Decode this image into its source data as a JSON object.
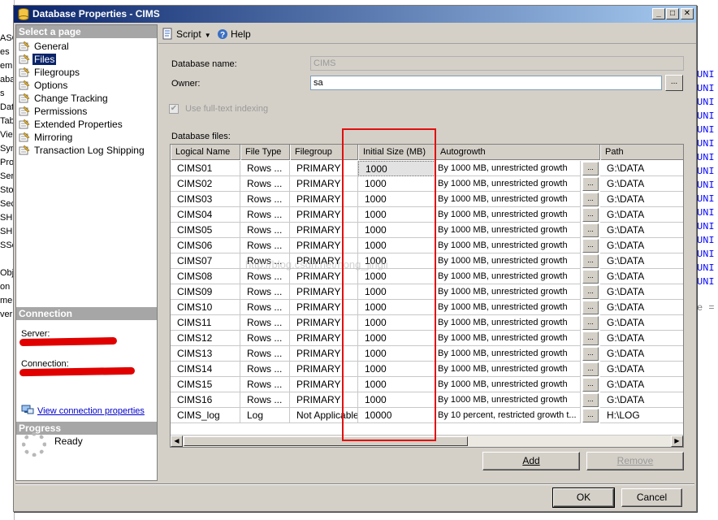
{
  "window": {
    "title": "Database Properties - CIMS",
    "controls": {
      "minimize": "_",
      "maximize": "□",
      "close": "✕"
    }
  },
  "left_pane": {
    "select_page_header": "Select a page",
    "pages": [
      {
        "label": "General",
        "selected": false
      },
      {
        "label": "Files",
        "selected": true
      },
      {
        "label": "Filegroups",
        "selected": false
      },
      {
        "label": "Options",
        "selected": false
      },
      {
        "label": "Change Tracking",
        "selected": false
      },
      {
        "label": "Permissions",
        "selected": false
      },
      {
        "label": "Extended Properties",
        "selected": false
      },
      {
        "label": "Mirroring",
        "selected": false
      },
      {
        "label": "Transaction Log Shipping",
        "selected": false
      }
    ],
    "connection_header": "Connection",
    "server_label": "Server:",
    "connection_label": "Connection:",
    "view_connection_link": "View connection properties",
    "progress_header": "Progress",
    "progress_status": "Ready"
  },
  "toolbar": {
    "script_label": "Script",
    "help_label": "Help"
  },
  "form": {
    "database_name_label": "Database name:",
    "database_name_value": "CIMS",
    "owner_label": "Owner:",
    "owner_value": "sa",
    "owner_browse": "...",
    "fulltext_label": "Use full-text indexing",
    "fulltext_checked": true,
    "database_files_label": "Database files:"
  },
  "grid": {
    "columns": [
      "Logical Name",
      "File Type",
      "Filegroup",
      "Initial Size (MB)",
      "Autogrowth",
      "Path"
    ],
    "rows": [
      [
        "CIMS01",
        "Rows ...",
        "PRIMARY",
        "1000",
        "By 1000 MB, unrestricted growth",
        "G:\\DATA"
      ],
      [
        "CIMS02",
        "Rows ...",
        "PRIMARY",
        "1000",
        "By 1000 MB, unrestricted growth",
        "G:\\DATA"
      ],
      [
        "CIMS03",
        "Rows ...",
        "PRIMARY",
        "1000",
        "By 1000 MB, unrestricted growth",
        "G:\\DATA"
      ],
      [
        "CIMS04",
        "Rows ...",
        "PRIMARY",
        "1000",
        "By 1000 MB, unrestricted growth",
        "G:\\DATA"
      ],
      [
        "CIMS05",
        "Rows ...",
        "PRIMARY",
        "1000",
        "By 1000 MB, unrestricted growth",
        "G:\\DATA"
      ],
      [
        "CIMS06",
        "Rows ...",
        "PRIMARY",
        "1000",
        "By 1000 MB, unrestricted growth",
        "G:\\DATA"
      ],
      [
        "CIMS07",
        "Rows ...",
        "PRIMARY",
        "1000",
        "By 1000 MB, unrestricted growth",
        "G:\\DATA"
      ],
      [
        "CIMS08",
        "Rows ...",
        "PRIMARY",
        "1000",
        "By 1000 MB, unrestricted growth",
        "G:\\DATA"
      ],
      [
        "CIMS09",
        "Rows ...",
        "PRIMARY",
        "1000",
        "By 1000 MB, unrestricted growth",
        "G:\\DATA"
      ],
      [
        "CIMS10",
        "Rows ...",
        "PRIMARY",
        "1000",
        "By 1000 MB, unrestricted growth",
        "G:\\DATA"
      ],
      [
        "CIMS11",
        "Rows ...",
        "PRIMARY",
        "1000",
        "By 1000 MB, unrestricted growth",
        "G:\\DATA"
      ],
      [
        "CIMS12",
        "Rows ...",
        "PRIMARY",
        "1000",
        "By 1000 MB, unrestricted growth",
        "G:\\DATA"
      ],
      [
        "CIMS13",
        "Rows ...",
        "PRIMARY",
        "1000",
        "By 1000 MB, unrestricted growth",
        "G:\\DATA"
      ],
      [
        "CIMS14",
        "Rows ...",
        "PRIMARY",
        "1000",
        "By 1000 MB, unrestricted growth",
        "G:\\DATA"
      ],
      [
        "CIMS15",
        "Rows ...",
        "PRIMARY",
        "1000",
        "By 1000 MB, unrestricted growth",
        "G:\\DATA"
      ],
      [
        "CIMS16",
        "Rows ...",
        "PRIMARY",
        "1000",
        "By 1000 MB, unrestricted growth",
        "G:\\DATA"
      ],
      [
        "CIMS_log",
        "Log",
        "Not Applicable",
        "10000",
        "By 10 percent, restricted growth t...",
        "H:\\LOG"
      ]
    ],
    "ellipsis": "...",
    "selected_row": 0
  },
  "buttons": {
    "add": "Add",
    "remove": "Remove",
    "ok": "OK",
    "cancel": "Cancel"
  },
  "watermark": "http://blog.csdn.net/hong_jingli",
  "background": {
    "left_fragments": [
      "ASQ",
      "es",
      "em",
      "aba",
      "s",
      "Dat",
      "Tab",
      "Viev",
      "Syn",
      "Pro",
      "Ser",
      "Sto",
      "Sec",
      "SHI",
      "SHI",
      "SSe",
      "",
      "Obje",
      "on",
      "mer",
      "ver"
    ],
    "right_keyword": "UNI",
    "right_eq": "e ="
  },
  "colors": {
    "title_gradient_start": "#0a246a",
    "title_gradient_end": "#a6caf0",
    "dialog_face": "#d4d0c8",
    "pane_header": "#a6a6a6",
    "highlight_annotation": "#e01010",
    "redaction": "#e00000",
    "link": "#0000cc"
  }
}
